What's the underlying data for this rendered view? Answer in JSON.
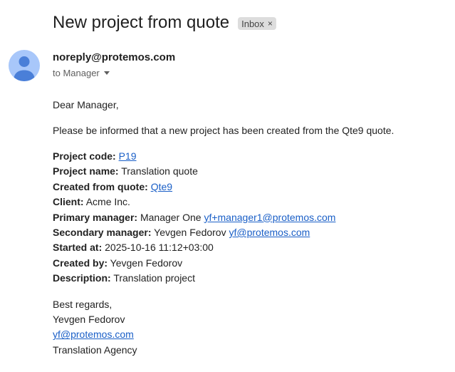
{
  "email": {
    "subject": "New project from quote",
    "label_chip": "Inbox",
    "label_remove_symbol": "×",
    "sender": "noreply@protemos.com",
    "recipients_text": "to Manager",
    "greeting": "Dear Manager,",
    "intro": "Please be informed that a new project has been created from the Qte9 quote.",
    "details": {
      "project_code_label": "Project code:",
      "project_code_value": "P19",
      "project_name_label": "Project name:",
      "project_name_value": "Translation quote",
      "created_from_label": "Created from quote:",
      "created_from_value": "Qte9",
      "client_label": "Client:",
      "client_value": "Acme Inc.",
      "primary_manager_label": "Primary manager:",
      "primary_manager_name": "Manager One",
      "primary_manager_email": "yf+manager1@protemos.com",
      "secondary_manager_label": "Secondary manager:",
      "secondary_manager_name": "Yevgen Fedorov",
      "secondary_manager_email": "yf@protemos.com",
      "started_at_label": "Started at:",
      "started_at_value": "2025-10-16 11:12+03:00",
      "created_by_label": "Created by:",
      "created_by_value": "Yevgen Fedorov",
      "description_label": "Description:",
      "description_value": "Translation project"
    },
    "signature": {
      "closing": "Best regards,",
      "name": "Yevgen Fedorov",
      "email": "yf@protemos.com",
      "company": "Translation Agency"
    }
  },
  "icons": {
    "avatar": "person-avatar-icon",
    "recipients_toggle": "caret-down-icon",
    "label_remove": "close-icon"
  },
  "colors": {
    "avatar_bg": "#a8c7fa",
    "avatar_figure": "#4a7fd8",
    "link": "#1a5fc7",
    "chip_bg": "#dddddd"
  }
}
